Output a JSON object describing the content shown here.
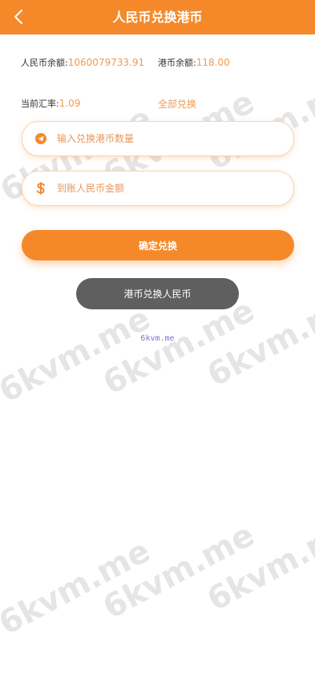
{
  "header": {
    "title": "人民币兑换港币",
    "back_icon": "chevron-left-icon"
  },
  "balances": {
    "rmb_label": "人民币余额:",
    "rmb_value": "1060079733.91",
    "hkd_label": "港币余额:",
    "hkd_value": "118.00"
  },
  "rate": {
    "label": "当前汇率:",
    "value": "1.09",
    "all_link": "全部兑换"
  },
  "inputs": {
    "hkd_amount": {
      "placeholder": "输入兑换港币数量",
      "value": "",
      "icon": "telegram-icon"
    },
    "rmb_amount": {
      "placeholder": "到账人民币金额",
      "value": "",
      "icon": "dollar-icon"
    }
  },
  "buttons": {
    "confirm": "确定兑换",
    "switch": "港币兑换人民币"
  },
  "footer": {
    "text": "6kvm.me"
  },
  "watermark": {
    "text": "6kvm.me"
  },
  "colors": {
    "accent": "#f5892a",
    "value_text": "#f09a50",
    "switch_button": "#5f5f5f"
  }
}
